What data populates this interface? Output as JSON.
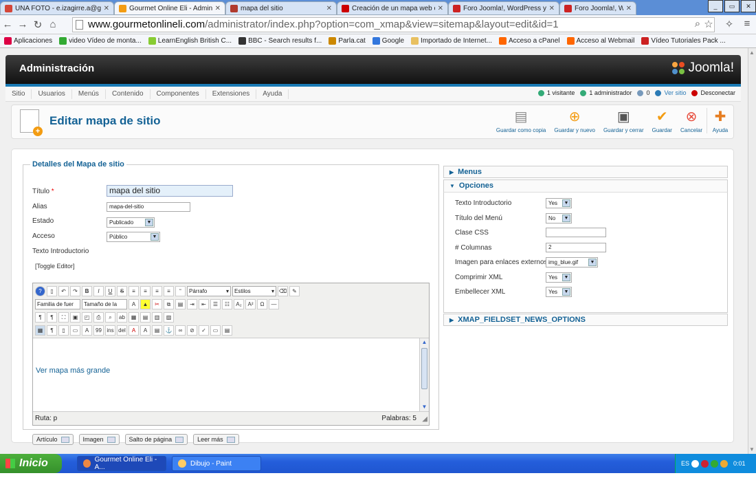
{
  "browser": {
    "tabs": [
      {
        "label": "UNA FOTO - e.izagirre.a@g",
        "color": "#d44638",
        "w": 166
      },
      {
        "label": "Gourmet Online Eli - Adminis",
        "color": "#f39c12",
        "w": 162,
        "active": true
      },
      {
        "label": "mapa del sitio",
        "color": "#b03a2e",
        "w": 162
      },
      {
        "label": "Creación de un mapa web c",
        "color": "#cc0000",
        "w": 162
      },
      {
        "label": "Foro Joomla!, WordPress y",
        "color": "#cc2222",
        "w": 162
      },
      {
        "label": "Foro Joomla!, Wor",
        "color": "#cc2222",
        "w": 112
      }
    ],
    "url_host": "www.gourmetonlineli.com",
    "url_path": "/administrator/index.php?option=com_xmap&view=sitemap&layout=edit&id=1",
    "bookmarks": [
      {
        "label": "Aplicaciones",
        "color": "#d04"
      },
      {
        "label": "video Vídeo de monta...",
        "color": "#3a3"
      },
      {
        "label": "LearnEnglish British C...",
        "color": "#8c3"
      },
      {
        "label": "BBC - Search results f...",
        "color": "#333"
      },
      {
        "label": "Parla.cat",
        "color": "#c80"
      },
      {
        "label": "Google",
        "color": "#37d"
      },
      {
        "label": "Importado de Internet...",
        "color": "#e8c060"
      },
      {
        "label": "Acceso a cPanel",
        "color": "#f60"
      },
      {
        "label": "Acceso al Webmail",
        "color": "#f60"
      },
      {
        "label": "Vídeo Tutoriales Pack ...",
        "color": "#c22"
      }
    ]
  },
  "admin": {
    "title": "Administración",
    "logo": "Joomla!",
    "menu": [
      "Sitio",
      "Usuarios",
      "Menús",
      "Contenido",
      "Componentes",
      "Extensiones",
      "Ayuda"
    ],
    "status": [
      {
        "label": "1 visitante",
        "color": "#3a7"
      },
      {
        "label": "1 administrador",
        "color": "#3a7"
      },
      {
        "label": "0",
        "color": "#79b"
      },
      {
        "label": "Ver sitio",
        "color": "#2a7ab5"
      },
      {
        "label": "Desconectar",
        "color": "#c00"
      }
    ]
  },
  "toolbar": {
    "title": "Editar mapa de sitio",
    "buttons": [
      {
        "label": "Guardar como copia",
        "name": "save-copy-button",
        "icon": "copy-icon"
      },
      {
        "label": "Guardar y nuevo",
        "name": "save-new-button",
        "icon": "plus-circle-icon"
      },
      {
        "label": "Guardar y cerrar",
        "name": "save-close-button",
        "icon": "floppy-icon"
      },
      {
        "label": "Guardar",
        "name": "save-button",
        "icon": "check-icon"
      },
      {
        "label": "Cancelar",
        "name": "cancel-button",
        "icon": "x-circle-icon"
      },
      {
        "label": "Ayuda",
        "name": "help-button",
        "icon": "lifebuoy-icon"
      }
    ]
  },
  "details": {
    "legend": "Detalles del Mapa de sitio",
    "title_label": "Título",
    "required": "*",
    "title_value": "mapa del sitio",
    "alias_label": "Alias",
    "alias_value": "mapa-del-sitio",
    "state_label": "Estado",
    "state_value": "Publicado",
    "access_label": "Acceso",
    "access_value": "Público",
    "intro_label": "Texto Introductorio",
    "toggle_editor": "[Toggle Editor]",
    "editor_format": "Párrafo",
    "editor_styles": "Estilos",
    "editor_font": "Familia de fuer",
    "editor_size": "Tamaño de la",
    "editor_text": "Ver mapa más grande",
    "path_label": "Ruta: p",
    "words_label": "Palabras: 5",
    "buttons": [
      "Artículo",
      "Imagen",
      "Salto de página",
      "Leer más"
    ]
  },
  "options": {
    "menus_header": "Menus",
    "options_header": "Opciones",
    "news_header": "XMAP_FIELDSET_NEWS_OPTIONS",
    "rows": [
      {
        "label": "Texto Introductorio",
        "value": "Yes",
        "type": "select"
      },
      {
        "label": "Título del Menú",
        "value": "No",
        "type": "select"
      },
      {
        "label": "Clase CSS",
        "value": "",
        "type": "input"
      },
      {
        "label": "# Columnas",
        "value": "2",
        "type": "input"
      },
      {
        "label": "Imagen para enlaces externos",
        "value": "img_blue.gif",
        "type": "select"
      },
      {
        "label": "Comprimir XML",
        "value": "Yes",
        "type": "select"
      },
      {
        "label": "Embellecer XML",
        "value": "Yes",
        "type": "select"
      }
    ]
  },
  "taskbar": {
    "start": "Inicio",
    "tasks": [
      {
        "label": "Gourmet Online Eli - A...",
        "color": "#e84",
        "active": true
      },
      {
        "label": "Dibujo - Paint",
        "color": "#fc6"
      }
    ],
    "lang": "ES",
    "time": "0:01"
  }
}
